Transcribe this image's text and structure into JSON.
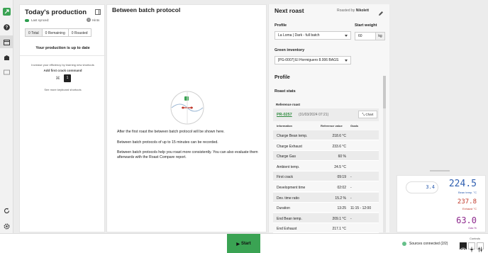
{
  "rail": {
    "icons": [
      "leaf-logo-icon",
      "help-icon",
      "production-icon",
      "inventory-icon",
      "messages-icon",
      "sync-icon",
      "settings-icon"
    ]
  },
  "production": {
    "title": "Today's production",
    "sync_status": "Last synced:",
    "hints_label": "Hints",
    "tabs": [
      "0 Total",
      "0 Remaining",
      "0 Roasted"
    ],
    "up_to_date": "Your production is up to date",
    "efficiency_tip": "Increase your efficiency by learning new shortcuts",
    "first_crack_label": "Add first crack command",
    "key_modifier": "⌘",
    "key_value": "1",
    "more_shortcuts": "See more keyboard shortcuts"
  },
  "between_batch": {
    "title": "Between batch protocol",
    "line1": "After the first roast the between batch protocol will be shown here.",
    "line2": "Between batch protocols of up to 15 minutes can be recorded.",
    "line3": "Between batch protocols help you roast more consistently. You can also evaluate them afterwards with the Roast Compare report."
  },
  "next_roast": {
    "title": "Next roast",
    "roasted_by_label": "Roasted by",
    "roasted_by_name": "Nikolett",
    "profile_label": "Profile",
    "profile_value": "La Loma | Dark - full batch",
    "start_weight_label": "Start weight",
    "start_weight_value": "60",
    "start_weight_unit": "kg",
    "green_inventory_label": "Green inventory",
    "green_inventory_value": "[PG-0007] El Hormiguero 8.006 BAGS",
    "profile_section": "Profile",
    "roast_stats": "Roast stats",
    "reference_roast_label": "Reference roast",
    "reference_id": "PR-0257",
    "reference_date": "(31/03/2024 07:21)",
    "chart_button": "Chart",
    "table_headers": [
      "Information",
      "Reference value",
      "Goals"
    ],
    "rows": [
      [
        "Charge Bean temp.",
        "218.6 °C",
        ""
      ],
      [
        "Charge Exhaust",
        "233.6 °C",
        ""
      ],
      [
        "Charge Gas",
        "60 %",
        ""
      ],
      [
        "Ambient temp.",
        "24.5 °C",
        ""
      ],
      [
        "First crack",
        "09:19",
        "-"
      ],
      [
        "Development time",
        "02:02",
        "-"
      ],
      [
        "Dev. time ratio",
        "15.2 %",
        "-"
      ],
      [
        "Duration",
        "13:25",
        "11:15 - 12:00"
      ],
      [
        "End Bean temp.",
        "209.1 °C",
        "-"
      ],
      [
        "End Exhaust",
        "217.1 °C",
        ""
      ]
    ]
  },
  "readouts": {
    "ror_value": "3.4",
    "bean_temp_value": "224.5",
    "bean_temp_caption": "Bean temp. °C",
    "exhaust_value": "237.8",
    "exhaust_caption": "Exhaust °C",
    "gas_value": "63.0",
    "gas_caption": "Gas %"
  },
  "bottom_bar": {
    "start_label": "Start",
    "sources": "Sources connected (2/2)",
    "controls_label": "Controls"
  },
  "colors": {
    "accent_green": "#3aa353",
    "bean_temp_blue": "#2f5fb0",
    "exhaust_red": "#c0392b",
    "gas_purple": "#8e2a8e"
  }
}
